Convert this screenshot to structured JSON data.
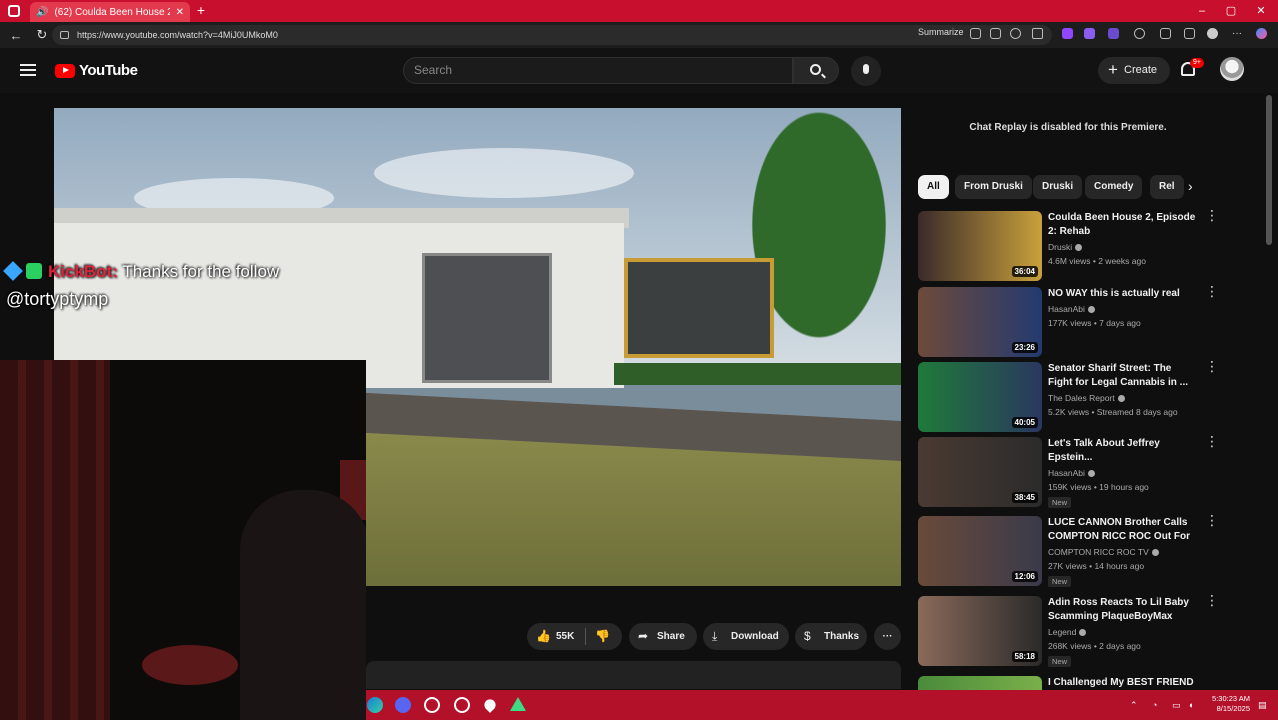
{
  "browser": {
    "tab_title": "(62) Coulda Been House 2, E",
    "new_tab": "+",
    "url": "https://www.youtube.com/watch?v=4MiJ0UMkoM0",
    "summarize_label": "Summarize",
    "window_controls": [
      "–",
      "▢",
      "✕"
    ]
  },
  "header": {
    "logo_text": "YouTube",
    "search_placeholder": "Search",
    "create_label": "Create",
    "notification_count": "9+"
  },
  "overlay": {
    "bot_name": "KickBot:",
    "message": " Thanks for the follow",
    "username": "@tortyptymp"
  },
  "actions": {
    "likes": "55K",
    "share": "Share",
    "download": "Download",
    "thanks": "Thanks",
    "more": "···"
  },
  "sidebar": {
    "chat_replay": "Chat Replay is disabled for this Premiere.",
    "chips": [
      "All",
      "From Druski",
      "Druski",
      "Comedy",
      "Rel"
    ],
    "recommendations": [
      {
        "title": "Coulda Been House 2, Episode 2: Rehab",
        "channel": "Druski",
        "meta": "4.6M views • 2 weeks ago",
        "duration": "36:04",
        "badge": "",
        "colors": [
          "#3a2a2a",
          "#c9a13b"
        ]
      },
      {
        "title": "NO WAY this is actually real",
        "channel": "HasanAbi",
        "meta": "177K views • 7 days ago",
        "duration": "23:26",
        "badge": "",
        "colors": [
          "#6d4a3a",
          "#243a70"
        ]
      },
      {
        "title": "Senator Sharif Street: The Fight for Legal Cannabis in ...",
        "channel": "The Dales Report",
        "meta": "5.2K views • Streamed 8 days ago",
        "duration": "40:05",
        "badge": "",
        "colors": [
          "#1f7a3a",
          "#2a3760"
        ]
      },
      {
        "title": "Let's Talk About Jeffrey Epstein...",
        "channel": "HasanAbi",
        "meta": "159K views • 19 hours ago",
        "duration": "38:45",
        "badge": "New",
        "colors": [
          "#4a3a32",
          "#2b2b2b"
        ]
      },
      {
        "title": "LUCE CANNON Brother Calls COMPTON RICC ROC Out For ...",
        "channel": "COMPTON RICC ROC TV",
        "meta": "27K views • 14 hours ago",
        "duration": "12:06",
        "badge": "New",
        "colors": [
          "#6a4a3a",
          "#3a3a4a"
        ]
      },
      {
        "title": "Adin Ross Reacts To Lil Baby Scamming PlaqueBoyMax",
        "channel": "Legend",
        "meta": "268K views • 2 days ago",
        "duration": "58:18",
        "badge": "New",
        "colors": [
          "#8a6a5a",
          "#2a2a2a"
        ]
      },
      {
        "title": "I Challenged My BEST FRIEND",
        "channel": "",
        "meta": "",
        "duration": "",
        "badge": "",
        "colors": [
          "#4a8a3a",
          "#7ab04a"
        ]
      }
    ]
  },
  "taskbar": {
    "time": "5:30:23 AM",
    "date": "8/15/2025"
  }
}
